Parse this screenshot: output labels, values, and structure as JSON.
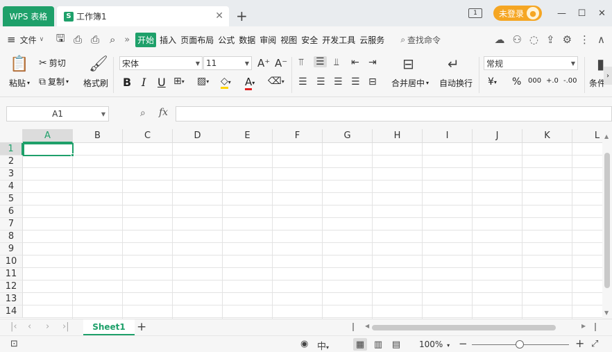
{
  "titlebar": {
    "app_tab": "WPS 表格",
    "doc_tab": "工作簿1",
    "doc_icon_letter": "S",
    "close_glyph": "✕",
    "new_tab_glyph": "+",
    "window_count_badge": "1",
    "login_label": "未登录",
    "login_color": "#f5a623",
    "brand_color": "#1ea06a"
  },
  "menubar": {
    "file_label": "文件",
    "tabs": [
      "开始",
      "插入",
      "页面布局",
      "公式",
      "数据",
      "审阅",
      "视图",
      "安全",
      "开发工具",
      "云服务"
    ],
    "active_tab": "开始",
    "find_command": "查找命令"
  },
  "ribbon": {
    "paste": "粘贴",
    "cut": "剪切",
    "copy": "复制",
    "format_painter": "格式刷",
    "font_name": "宋体",
    "font_size": "11",
    "bold": "B",
    "italic": "I",
    "underline": "U",
    "font_color_letter": "A",
    "merge_center": "合并居中",
    "wrap_text": "自动换行",
    "number_format": "常规",
    "currency": "¥",
    "percent": "%",
    "thousands": "000",
    "inc_decimal": "+.0",
    "dec_decimal": "-.00",
    "conditional": "条件"
  },
  "formulabar": {
    "name_box": "A1",
    "fx": "fx",
    "formula_value": ""
  },
  "grid": {
    "columns": [
      "A",
      "B",
      "C",
      "D",
      "E",
      "F",
      "G",
      "H",
      "I",
      "J",
      "K",
      "L"
    ],
    "rows": [
      "1",
      "2",
      "3",
      "4",
      "5",
      "6",
      "7",
      "8",
      "9",
      "10",
      "11",
      "12",
      "13",
      "14"
    ],
    "active_column": "A",
    "active_row": "1"
  },
  "sheets": {
    "tabs": [
      "Sheet1"
    ],
    "active": "Sheet1",
    "add_glyph": "+"
  },
  "status": {
    "zoom": "100%",
    "zoom_minus": "−",
    "zoom_plus": "+"
  }
}
